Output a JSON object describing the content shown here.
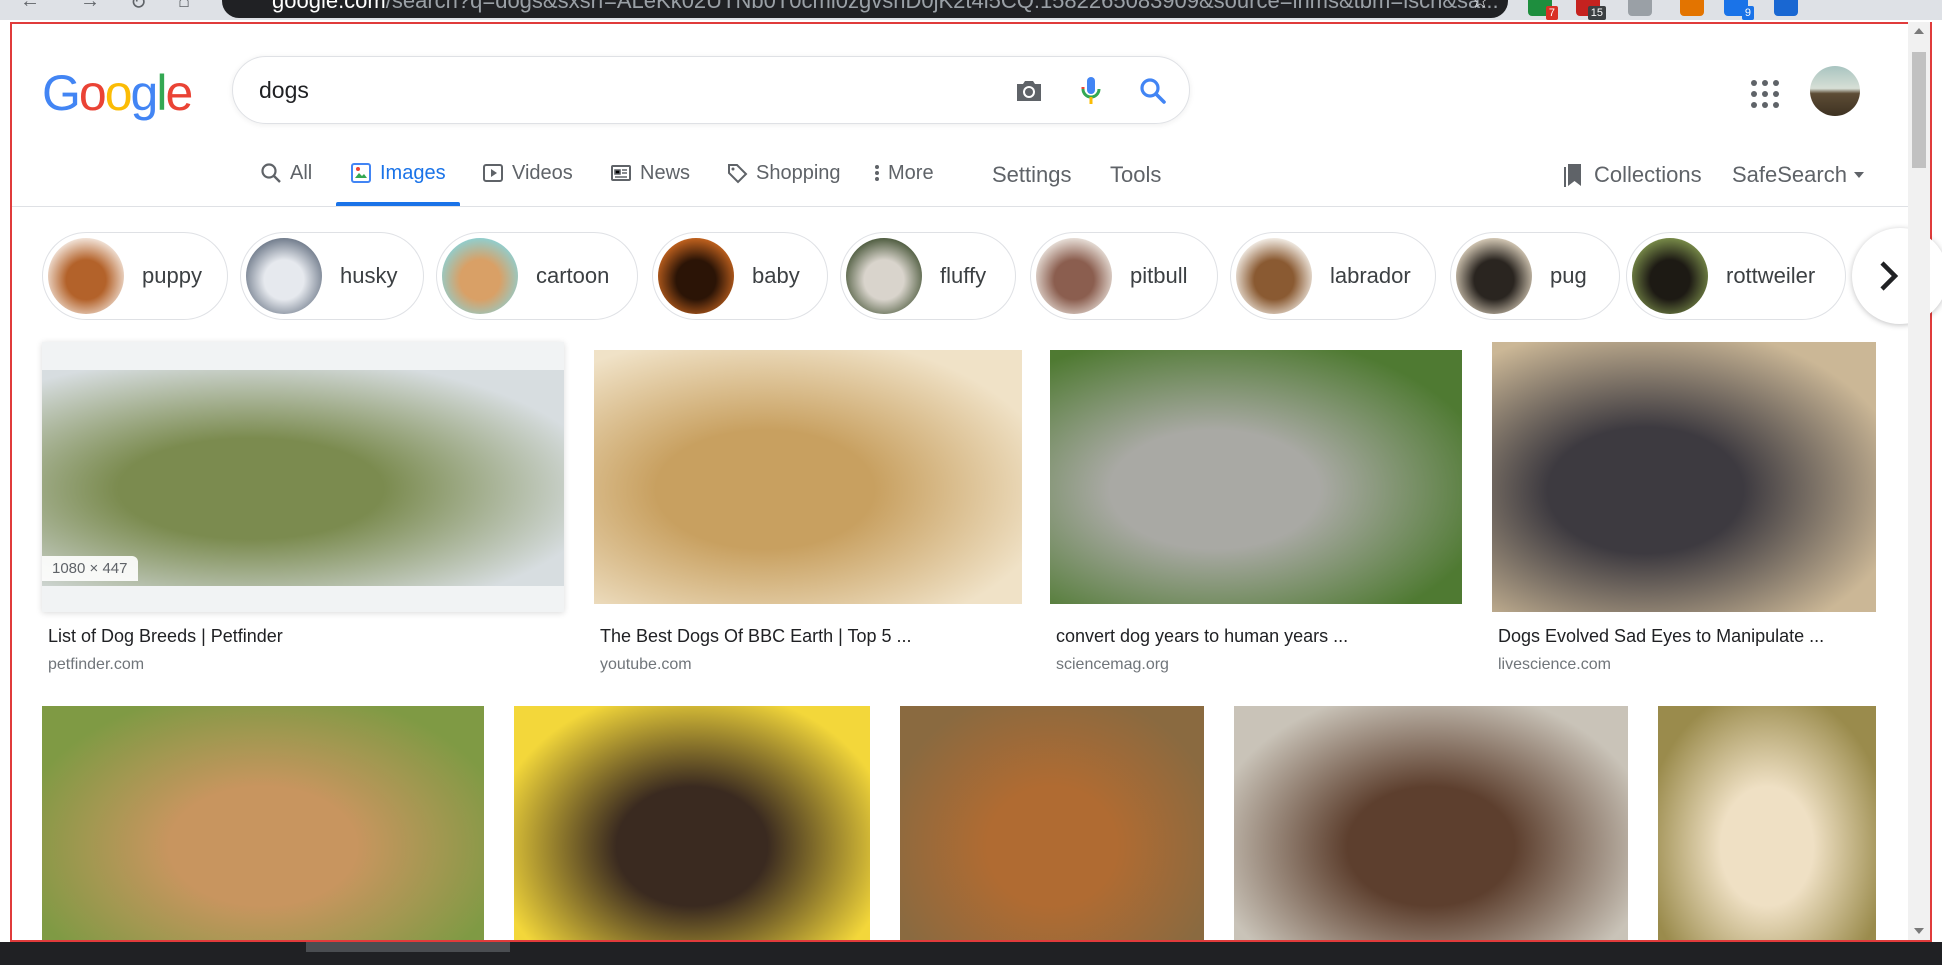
{
  "browser": {
    "url_host": "google.com",
    "url_rest": "/search?q=dogs&sxsrf=ALeKk02UTNb0T0cmi0zgvsnD0jK2t4l5CQ:1582265083909&source=lnms&tbm=isch&sa...",
    "extensions": [
      {
        "name": "ext-1",
        "badge": "7",
        "color": "#1e8e3e"
      },
      {
        "name": "ext-2",
        "badge": "15",
        "color": "#c5221f"
      },
      {
        "name": "ext-3",
        "badge": "",
        "color": "#9aa0a6"
      },
      {
        "name": "ext-4",
        "badge": "",
        "color": "#e37400"
      },
      {
        "name": "ext-5",
        "badge": "9",
        "color": "#1a73e8"
      },
      {
        "name": "ext-6",
        "badge": "",
        "color": "#1967d2"
      }
    ]
  },
  "logo": {
    "letters": [
      "G",
      "o",
      "o",
      "g",
      "l",
      "e"
    ],
    "colors": [
      "#4285F4",
      "#EA4335",
      "#FBBC05",
      "#4285F4",
      "#34A853",
      "#EA4335"
    ]
  },
  "search": {
    "query": "dogs"
  },
  "tabs": [
    {
      "label": "All",
      "icon": "search-icon"
    },
    {
      "label": "Images",
      "icon": "image-icon",
      "active": true
    },
    {
      "label": "Videos",
      "icon": "play-icon"
    },
    {
      "label": "News",
      "icon": "news-icon"
    },
    {
      "label": "Shopping",
      "icon": "tag-icon"
    },
    {
      "label": "More",
      "icon": "more-vert-icon"
    }
  ],
  "tools": {
    "settings": "Settings",
    "tools": "Tools",
    "collections": "Collections",
    "safesearch": "SafeSearch"
  },
  "chips": [
    {
      "label": "puppy",
      "colors": [
        "#f3e6dc",
        "#b3622a"
      ]
    },
    {
      "label": "husky",
      "colors": [
        "#6f7a8a",
        "#e6e9ee"
      ]
    },
    {
      "label": "cartoon",
      "colors": [
        "#8fcfd0",
        "#d9a066"
      ]
    },
    {
      "label": "baby",
      "colors": [
        "#c5641f",
        "#2b1406"
      ]
    },
    {
      "label": "fluffy",
      "colors": [
        "#4c5a3d",
        "#d9d4cc"
      ]
    },
    {
      "label": "pitbull",
      "colors": [
        "#e9e1da",
        "#8b5e4f"
      ]
    },
    {
      "label": "labrador",
      "colors": [
        "#f4efe8",
        "#8a5a32"
      ]
    },
    {
      "label": "pug",
      "colors": [
        "#d8ccb8",
        "#2a2520"
      ]
    },
    {
      "label": "rottweiler",
      "colors": [
        "#7a8d4a",
        "#1d1a14"
      ]
    }
  ],
  "results_row1": [
    {
      "title": "List of Dog Breeds | Petfinder",
      "source": "petfinder.com",
      "dims": "1080 × 447",
      "colors": [
        "#d7dde0",
        "#7b8b4f"
      ]
    },
    {
      "title": "The Best Dogs Of BBC Earth | Top 5 ...",
      "source": "youtube.com",
      "colors": [
        "#f0e2c7",
        "#c8a060"
      ]
    },
    {
      "title": "convert dog years to human years ...",
      "source": "sciencemag.org",
      "colors": [
        "#4f7a32",
        "#a9a9a4"
      ]
    },
    {
      "title": "Dogs Evolved Sad Eyes to Manipulate ...",
      "source": "livescience.com",
      "colors": [
        "#cbb796",
        "#3d3a40"
      ]
    }
  ],
  "results_row2": [
    {
      "colors": [
        "#7f9a44",
        "#c8955f"
      ]
    },
    {
      "colors": [
        "#f3d73a",
        "#3a2a20"
      ]
    },
    {
      "colors": [
        "#8a6a40",
        "#b06b32"
      ]
    },
    {
      "colors": [
        "#c9c3b8",
        "#5d3f2e"
      ]
    },
    {
      "colors": [
        "#9a8b4c",
        "#efe0c4"
      ]
    }
  ]
}
